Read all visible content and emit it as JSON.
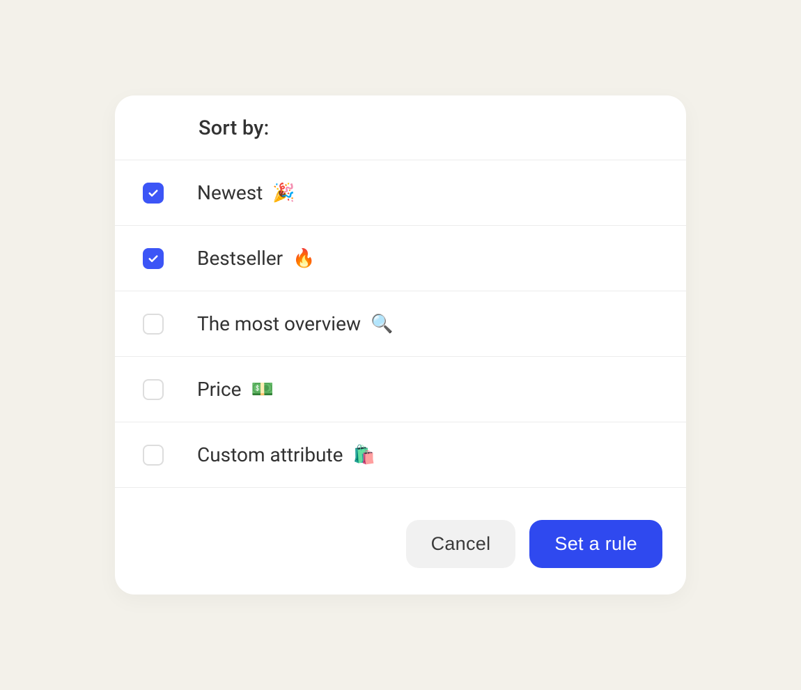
{
  "header": {
    "title": "Sort by:"
  },
  "options": [
    {
      "label": "Newest",
      "emoji": "🎉",
      "checked": true
    },
    {
      "label": "Bestseller",
      "emoji": "🔥",
      "checked": true
    },
    {
      "label": "The most overview",
      "emoji": "🔍",
      "checked": false
    },
    {
      "label": "Price",
      "emoji": "💵",
      "checked": false
    },
    {
      "label": "Custom attribute",
      "emoji": "🛍️",
      "checked": false
    }
  ],
  "footer": {
    "cancel_label": "Cancel",
    "confirm_label": "Set a rule"
  },
  "colors": {
    "accent": "#2f49ef",
    "checkbox_fill": "#3c55f6",
    "page_bg": "#f3f1ea",
    "card_bg": "#ffffff",
    "divider": "#ececec",
    "text": "#323232",
    "btn_secondary_bg": "#f1f1f1"
  }
}
